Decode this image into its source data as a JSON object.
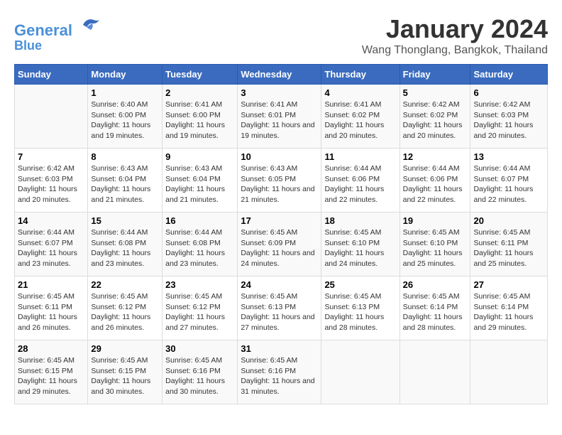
{
  "header": {
    "logo_line1": "General",
    "logo_line2": "Blue",
    "month": "January 2024",
    "location": "Wang Thonglang, Bangkok, Thailand"
  },
  "weekdays": [
    "Sunday",
    "Monday",
    "Tuesday",
    "Wednesday",
    "Thursday",
    "Friday",
    "Saturday"
  ],
  "weeks": [
    [
      {
        "day": "",
        "sunrise": "",
        "sunset": "",
        "daylight": ""
      },
      {
        "day": "1",
        "sunrise": "Sunrise: 6:40 AM",
        "sunset": "Sunset: 6:00 PM",
        "daylight": "Daylight: 11 hours and 19 minutes."
      },
      {
        "day": "2",
        "sunrise": "Sunrise: 6:41 AM",
        "sunset": "Sunset: 6:00 PM",
        "daylight": "Daylight: 11 hours and 19 minutes."
      },
      {
        "day": "3",
        "sunrise": "Sunrise: 6:41 AM",
        "sunset": "Sunset: 6:01 PM",
        "daylight": "Daylight: 11 hours and 19 minutes."
      },
      {
        "day": "4",
        "sunrise": "Sunrise: 6:41 AM",
        "sunset": "Sunset: 6:02 PM",
        "daylight": "Daylight: 11 hours and 20 minutes."
      },
      {
        "day": "5",
        "sunrise": "Sunrise: 6:42 AM",
        "sunset": "Sunset: 6:02 PM",
        "daylight": "Daylight: 11 hours and 20 minutes."
      },
      {
        "day": "6",
        "sunrise": "Sunrise: 6:42 AM",
        "sunset": "Sunset: 6:03 PM",
        "daylight": "Daylight: 11 hours and 20 minutes."
      }
    ],
    [
      {
        "day": "7",
        "sunrise": "Sunrise: 6:42 AM",
        "sunset": "Sunset: 6:03 PM",
        "daylight": "Daylight: 11 hours and 20 minutes."
      },
      {
        "day": "8",
        "sunrise": "Sunrise: 6:43 AM",
        "sunset": "Sunset: 6:04 PM",
        "daylight": "Daylight: 11 hours and 21 minutes."
      },
      {
        "day": "9",
        "sunrise": "Sunrise: 6:43 AM",
        "sunset": "Sunset: 6:04 PM",
        "daylight": "Daylight: 11 hours and 21 minutes."
      },
      {
        "day": "10",
        "sunrise": "Sunrise: 6:43 AM",
        "sunset": "Sunset: 6:05 PM",
        "daylight": "Daylight: 11 hours and 21 minutes."
      },
      {
        "day": "11",
        "sunrise": "Sunrise: 6:44 AM",
        "sunset": "Sunset: 6:06 PM",
        "daylight": "Daylight: 11 hours and 22 minutes."
      },
      {
        "day": "12",
        "sunrise": "Sunrise: 6:44 AM",
        "sunset": "Sunset: 6:06 PM",
        "daylight": "Daylight: 11 hours and 22 minutes."
      },
      {
        "day": "13",
        "sunrise": "Sunrise: 6:44 AM",
        "sunset": "Sunset: 6:07 PM",
        "daylight": "Daylight: 11 hours and 22 minutes."
      }
    ],
    [
      {
        "day": "14",
        "sunrise": "Sunrise: 6:44 AM",
        "sunset": "Sunset: 6:07 PM",
        "daylight": "Daylight: 11 hours and 23 minutes."
      },
      {
        "day": "15",
        "sunrise": "Sunrise: 6:44 AM",
        "sunset": "Sunset: 6:08 PM",
        "daylight": "Daylight: 11 hours and 23 minutes."
      },
      {
        "day": "16",
        "sunrise": "Sunrise: 6:44 AM",
        "sunset": "Sunset: 6:08 PM",
        "daylight": "Daylight: 11 hours and 23 minutes."
      },
      {
        "day": "17",
        "sunrise": "Sunrise: 6:45 AM",
        "sunset": "Sunset: 6:09 PM",
        "daylight": "Daylight: 11 hours and 24 minutes."
      },
      {
        "day": "18",
        "sunrise": "Sunrise: 6:45 AM",
        "sunset": "Sunset: 6:10 PM",
        "daylight": "Daylight: 11 hours and 24 minutes."
      },
      {
        "day": "19",
        "sunrise": "Sunrise: 6:45 AM",
        "sunset": "Sunset: 6:10 PM",
        "daylight": "Daylight: 11 hours and 25 minutes."
      },
      {
        "day": "20",
        "sunrise": "Sunrise: 6:45 AM",
        "sunset": "Sunset: 6:11 PM",
        "daylight": "Daylight: 11 hours and 25 minutes."
      }
    ],
    [
      {
        "day": "21",
        "sunrise": "Sunrise: 6:45 AM",
        "sunset": "Sunset: 6:11 PM",
        "daylight": "Daylight: 11 hours and 26 minutes."
      },
      {
        "day": "22",
        "sunrise": "Sunrise: 6:45 AM",
        "sunset": "Sunset: 6:12 PM",
        "daylight": "Daylight: 11 hours and 26 minutes."
      },
      {
        "day": "23",
        "sunrise": "Sunrise: 6:45 AM",
        "sunset": "Sunset: 6:12 PM",
        "daylight": "Daylight: 11 hours and 27 minutes."
      },
      {
        "day": "24",
        "sunrise": "Sunrise: 6:45 AM",
        "sunset": "Sunset: 6:13 PM",
        "daylight": "Daylight: 11 hours and 27 minutes."
      },
      {
        "day": "25",
        "sunrise": "Sunrise: 6:45 AM",
        "sunset": "Sunset: 6:13 PM",
        "daylight": "Daylight: 11 hours and 28 minutes."
      },
      {
        "day": "26",
        "sunrise": "Sunrise: 6:45 AM",
        "sunset": "Sunset: 6:14 PM",
        "daylight": "Daylight: 11 hours and 28 minutes."
      },
      {
        "day": "27",
        "sunrise": "Sunrise: 6:45 AM",
        "sunset": "Sunset: 6:14 PM",
        "daylight": "Daylight: 11 hours and 29 minutes."
      }
    ],
    [
      {
        "day": "28",
        "sunrise": "Sunrise: 6:45 AM",
        "sunset": "Sunset: 6:15 PM",
        "daylight": "Daylight: 11 hours and 29 minutes."
      },
      {
        "day": "29",
        "sunrise": "Sunrise: 6:45 AM",
        "sunset": "Sunset: 6:15 PM",
        "daylight": "Daylight: 11 hours and 30 minutes."
      },
      {
        "day": "30",
        "sunrise": "Sunrise: 6:45 AM",
        "sunset": "Sunset: 6:16 PM",
        "daylight": "Daylight: 11 hours and 30 minutes."
      },
      {
        "day": "31",
        "sunrise": "Sunrise: 6:45 AM",
        "sunset": "Sunset: 6:16 PM",
        "daylight": "Daylight: 11 hours and 31 minutes."
      },
      {
        "day": "",
        "sunrise": "",
        "sunset": "",
        "daylight": ""
      },
      {
        "day": "",
        "sunrise": "",
        "sunset": "",
        "daylight": ""
      },
      {
        "day": "",
        "sunrise": "",
        "sunset": "",
        "daylight": ""
      }
    ]
  ]
}
